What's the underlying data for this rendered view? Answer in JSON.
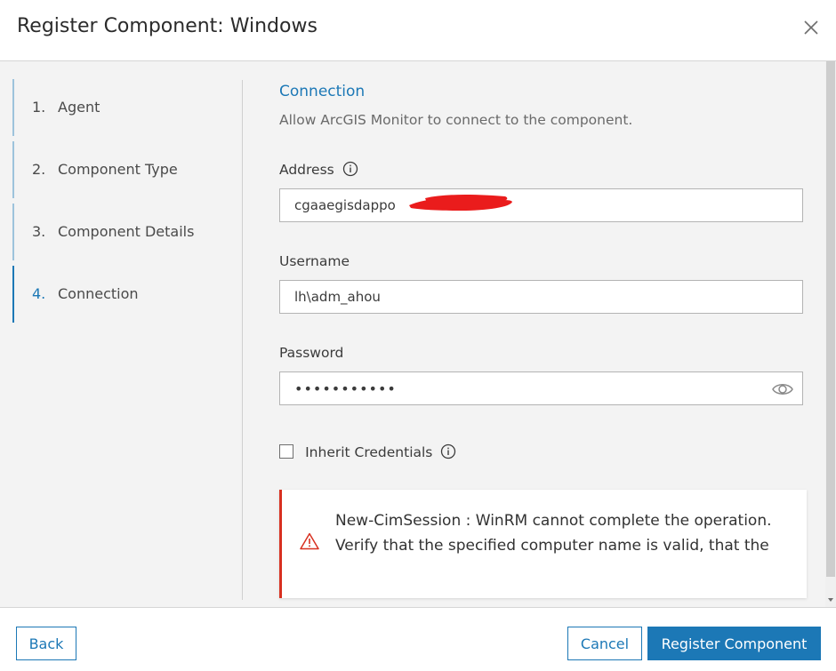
{
  "dialog": {
    "title": "Register Component: Windows"
  },
  "steps": [
    {
      "number": "1.",
      "label": "Agent"
    },
    {
      "number": "2.",
      "label": "Component Type"
    },
    {
      "number": "3.",
      "label": "Component Details"
    },
    {
      "number": "4.",
      "label": "Connection",
      "active": true
    }
  ],
  "connection": {
    "title": "Connection",
    "description": "Allow ArcGIS Monitor to connect to the component.",
    "address": {
      "label": "Address",
      "value": "cgaaegisdappo"
    },
    "username": {
      "label": "Username",
      "value": "lh\\adm_ahou"
    },
    "password": {
      "label": "Password",
      "value": "•••••••••••"
    },
    "inherit_credentials": {
      "label": "Inherit Credentials",
      "checked": false
    }
  },
  "alert": {
    "message": "New-CimSession : WinRM cannot complete the operation. Verify that the specified computer name is valid, that the"
  },
  "footer": {
    "back_label": "Back",
    "cancel_label": "Cancel",
    "register_label": "Register Component"
  },
  "colors": {
    "accent": "#1c78b6",
    "error": "#d83020"
  },
  "icons": {
    "close": "close-icon",
    "info": "info-icon",
    "eye": "eye-icon",
    "warning": "warning-icon"
  }
}
